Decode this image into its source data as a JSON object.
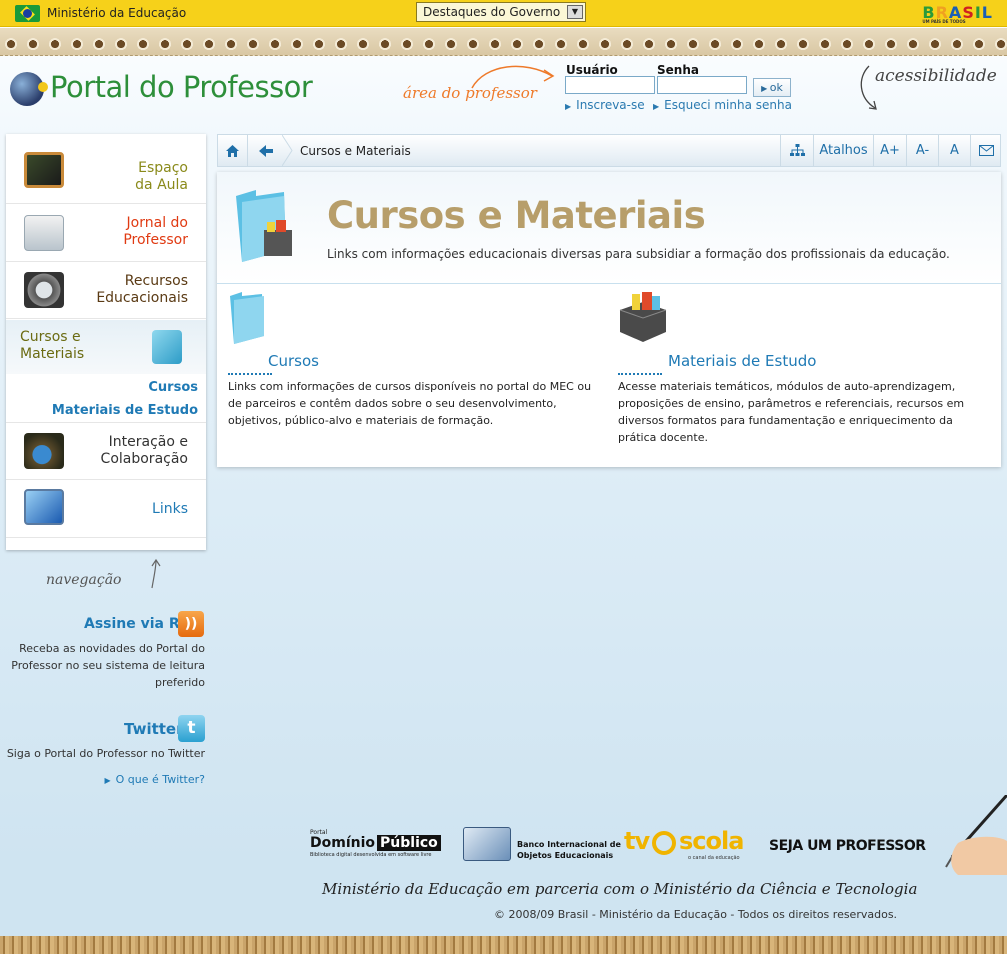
{
  "govbar": {
    "ministry": "Ministério da Educação",
    "dropdown": "Destaques do Governo",
    "brand": "BRASIL",
    "brand_sub": "UM PAÍS DE TODOS"
  },
  "header": {
    "logo": "Portal do Professor",
    "area": "área do professor",
    "user_label": "Usuário",
    "pass_label": "Senha",
    "ok": "ok",
    "signup": "Inscreva-se",
    "forgot": "Esqueci minha senha",
    "accessibility": "acessibilidade"
  },
  "sidebar": {
    "items": [
      {
        "label1": "Espaço",
        "label2": "da Aula",
        "color": "#8a8a1a",
        "icon": "chalkboard-icon"
      },
      {
        "label1": "Jornal do",
        "label2": "Professor",
        "color": "#e03a12",
        "icon": "newspaper-icon"
      },
      {
        "label1": "Recursos",
        "label2": "Educacionais",
        "color": "#5a3a14",
        "icon": "film-reel-icon"
      },
      {
        "label1": "Cursos e",
        "label2": "Materiais",
        "color": "#6b6b12",
        "icon": "box-folder-icon"
      },
      {
        "label1": "Interação e",
        "label2": "Colaboração",
        "color": "#333333",
        "icon": "people-globe-icon"
      },
      {
        "label1": "Links",
        "label2": "",
        "color": "#1f7ab5",
        "icon": "monitor-globe-icon"
      }
    ],
    "sub_items": [
      "Cursos",
      "Materiais de Estudo"
    ],
    "nav_script": "navegação",
    "rss_title": "Assine via RSS",
    "rss_text": [
      "Receba as novidades do Portal do",
      "Professor no seu sistema de leitura",
      "preferido"
    ],
    "twitter_title": "Twitter",
    "twitter_text": "Siga o Portal do Professor no Twitter",
    "twitter_link": "O que é Twitter?"
  },
  "toolbar": {
    "breadcrumb": "Cursos e Materiais",
    "shortcuts": "Atalhos",
    "font_up": "A+",
    "font_down": "A-",
    "font_reset": "A"
  },
  "content": {
    "title": "Cursos e Materiais",
    "description": "Links com informações educacionais diversas para subsidiar a formação dos profissionais da educação.",
    "columns": [
      {
        "title": "Cursos",
        "lines": [
          "Links com informações de cursos disponíveis no portal do MEC ou",
          "de parceiros e contêm dados sobre o seu desenvolvimento,",
          "objetivos, público-alvo e materiais de formação."
        ]
      },
      {
        "title": "Materiais de Estudo",
        "lines": [
          "Acesse materiais temáticos, módulos de auto-aprendizagem,",
          "proposições de ensino, parâmetros e referenciais, recursos em",
          "diversos formatos para fundamentação e enriquecimento da",
          "prática docente."
        ]
      }
    ]
  },
  "footer": {
    "dp_small": "Portal",
    "dp_main1": "Domínio",
    "dp_main2": "Público",
    "dp_sub": "Biblioteca digital desenvolvida em software livre",
    "bio_line1": "Banco Internacional de",
    "bio_line2": "Objetos Educacionais",
    "tv1": "tv",
    "tv2": "scola",
    "tv_sub": "o canal da educação",
    "seja": "SEJA UM PROFESSOR",
    "partnership": "Ministério da Educação em parceria com o Ministério da Ciência e Tecnologia",
    "copyright": "© 2008/09 Brasil - Ministério da Educação - Todos os direitos reservados."
  }
}
